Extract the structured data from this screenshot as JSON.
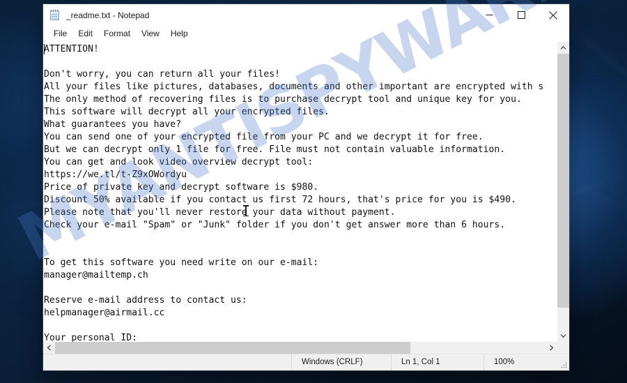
{
  "window": {
    "title": "_readme.txt - Notepad",
    "icon": "notepad-icon",
    "controls": {
      "minimize": "minimize-button",
      "maximize": "maximize-button",
      "close": "close-button"
    }
  },
  "menubar": {
    "items": [
      {
        "label": "File"
      },
      {
        "label": "Edit"
      },
      {
        "label": "Format"
      },
      {
        "label": "View"
      },
      {
        "label": "Help"
      }
    ]
  },
  "editor": {
    "content": "ATTENTION!\n\nDon't worry, you can return all your files!\nAll your files like pictures, databases, documents and other important are encrypted with s\nThe only method of recovering files is to purchase decrypt tool and unique key for you.\nThis software will decrypt all your encrypted files.\nWhat guarantees you have?\nYou can send one of your encrypted file from your PC and we decrypt it for free.\nBut we can decrypt only 1 file for free. File must not contain valuable information.\nYou can get and look video overview decrypt tool:\nhttps://we.tl/t-Z9xOWordyu\nPrice of private key and decrypt software is $980.\nDiscount 50% available if you contact us first 72 hours, that's price for you is $490.\nPlease note that you'll never restore your data without payment.\nCheck your e-mail \"Spam\" or \"Junk\" folder if you don't get answer more than 6 hours.\n\n\nTo get this software you need write on our e-mail:\nmanager@mailtemp.ch\n\nReserve e-mail address to contact us:\nhelpmanager@airmail.cc\n\nYour personal ID:",
    "lines": [
      "ATTENTION!",
      "",
      "Don't worry, you can return all your files!",
      "All your files like pictures, databases, documents and other important are encrypted with s",
      "The only method of recovering files is to purchase decrypt tool and unique key for you.",
      "This software will decrypt all your encrypted files.",
      "What guarantees you have?",
      "You can send one of your encrypted file from your PC and we decrypt it for free.",
      "But we can decrypt only 1 file for free. File must not contain valuable information.",
      "You can get and look video overview decrypt tool:",
      "https://we.tl/t-Z9xOWordyu",
      "Price of private key and decrypt software is $980.",
      "Discount 50% available if you contact us first 72 hours, that's price for you is $490.",
      "Please note that you'll never restore your data without payment.",
      "Check your e-mail \"Spam\" or \"Junk\" folder if you don't get answer more than 6 hours.",
      "",
      "",
      "To get this software you need write on our e-mail:",
      "manager@mailtemp.ch",
      "",
      "Reserve e-mail address to contact us:",
      "helpmanager@airmail.cc",
      "",
      "Your personal ID:"
    ],
    "ransom_details": {
      "price_full": "$980",
      "price_discount": "$490",
      "discount_percent": "50%",
      "discount_window": "72 hours",
      "response_time": "6 hours",
      "video_url": "https://we.tl/t-Z9xOWordyu",
      "email_primary": "manager@mailtemp.ch",
      "email_reserve": "helpmanager@airmail.cc"
    }
  },
  "statusbar": {
    "line_ending": "Windows (CRLF)",
    "cursor_position": "Ln 1, Col 1",
    "zoom": "100%"
  },
  "watermark": {
    "text": "MYANTISPYWARE.COM"
  },
  "colors": {
    "window_bg": "#ffffff",
    "chrome_bg": "#f0f0f0",
    "text": "#111111",
    "scrollbar_thumb": "#cdcdcd",
    "desktop_accent": "#0d2a4a",
    "watermark": "#4678c8"
  }
}
